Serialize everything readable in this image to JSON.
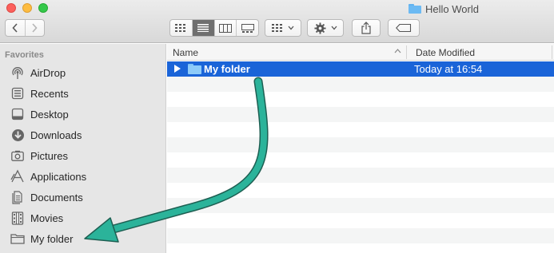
{
  "window": {
    "title": "Hello World"
  },
  "toolbar": {
    "back_icon": "chevron-left-icon",
    "forward_icon": "chevron-right-icon",
    "views": [
      "icon-view-icon",
      "list-view-icon",
      "column-view-icon",
      "gallery-view-icon"
    ],
    "active_view": "list",
    "arrange_icon": "arrange-grid-icon",
    "action_icon": "gear-icon",
    "share_icon": "share-icon",
    "tag_icon": "tag-icon"
  },
  "sidebar": {
    "header": "Favorites",
    "items": [
      {
        "label": "AirDrop",
        "icon": "airdrop-icon"
      },
      {
        "label": "Recents",
        "icon": "recents-icon"
      },
      {
        "label": "Desktop",
        "icon": "desktop-icon"
      },
      {
        "label": "Downloads",
        "icon": "downloads-icon"
      },
      {
        "label": "Pictures",
        "icon": "pictures-icon"
      },
      {
        "label": "Applications",
        "icon": "applications-icon"
      },
      {
        "label": "Documents",
        "icon": "documents-icon"
      },
      {
        "label": "Movies",
        "icon": "movies-icon"
      },
      {
        "label": "My folder",
        "icon": "folder-icon"
      }
    ]
  },
  "list": {
    "columns": {
      "name": "Name",
      "date": "Date Modified"
    },
    "rows": [
      {
        "name": "My folder",
        "date": "Today at 16:54",
        "selected": true
      }
    ]
  },
  "colors": {
    "selection": "#1a64d8",
    "annotation_arrow": "#2bb39a"
  }
}
